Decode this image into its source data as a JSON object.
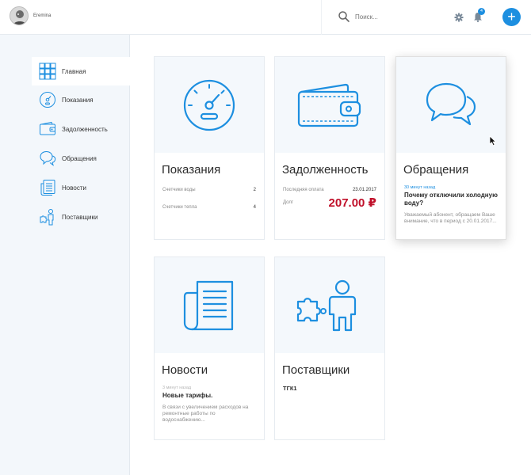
{
  "header": {
    "username": "Eremina",
    "search_placeholder": "Поиск...",
    "notifications_count": "4",
    "add_label": "+"
  },
  "sidebar": {
    "items": [
      {
        "label": "Главная",
        "icon": "grid-icon",
        "active": true
      },
      {
        "label": "Показания",
        "icon": "gauge-icon"
      },
      {
        "label": "Задолженность",
        "icon": "wallet-icon"
      },
      {
        "label": "Обращения",
        "icon": "chat-bubbles-icon"
      },
      {
        "label": "Новости",
        "icon": "newspaper-icon"
      },
      {
        "label": "Поставщики",
        "icon": "puzzle-person-icon"
      }
    ]
  },
  "cards": {
    "readings": {
      "title": "Показания",
      "rows": [
        {
          "label": "Счетчики воды",
          "value": "2"
        },
        {
          "label": "Счетчики тепла",
          "value": "4"
        }
      ]
    },
    "debt": {
      "title": "Задолженность",
      "last_payment_label": "Последняя оплата",
      "last_payment_date": "23.01.2017",
      "debt_label": "Долг",
      "amount": "207.00 ₽"
    },
    "requests": {
      "title": "Обращения",
      "timestamp": "30 минут назад",
      "headline": "Почему отключили холодную воду?",
      "snippet": "Уважаемый абонент, обращаем Ваше внимание, что в период с 20.01.2017..."
    },
    "news": {
      "title": "Новости",
      "timestamp": "3 минут назад",
      "headline": "Новые тарифы.",
      "snippet": "В связи с увеличением расходов на ремонтные работы по водоснабжению..."
    },
    "suppliers": {
      "title": "Поставщики",
      "item": "ТГК1"
    }
  },
  "colors": {
    "accent": "#1d8fe0",
    "debt_amount": "#c0102a",
    "sidebar_bg": "#f3f7fb",
    "card_hero_bg": "#f4f8fc"
  }
}
